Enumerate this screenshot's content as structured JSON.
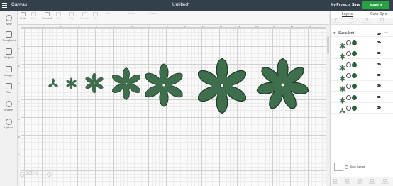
{
  "topbar": {
    "app_title": "Canvas",
    "doc_title": "Untitled*",
    "my_projects": "My Projects",
    "save": "Save",
    "make_it": "Make It"
  },
  "toolbar": {
    "items": [
      "Undo",
      "Redo",
      "Select All",
      "Edit",
      "Align",
      "Arrange",
      "Flip",
      "Size",
      "Rotate",
      "Position"
    ],
    "groups": [
      "Edit",
      "Align",
      "Arrange",
      "Flip",
      "Size",
      "Rotate",
      "Position"
    ]
  },
  "sidebar": {
    "items": [
      "New",
      "Templates",
      "Projects",
      "Images",
      "Text",
      "Shapes",
      "Upload"
    ]
  },
  "ruler": {
    "top": [
      "1",
      "2",
      "3",
      "4",
      "5",
      "6",
      "7",
      "8",
      "9",
      "10",
      "11",
      "12",
      "13",
      "14",
      "15",
      "16"
    ],
    "left": [
      "1",
      "2",
      "3",
      "4",
      "5",
      "6",
      "7"
    ]
  },
  "canvas": {
    "zoom": "100%",
    "fill_color": "#3f6e4d",
    "flowers": [
      {
        "petals": 3,
        "hole": false
      },
      {
        "petals": 6,
        "hole": false
      },
      {
        "petals": 6,
        "hole": true
      },
      {
        "petals": 6,
        "hole": true
      },
      {
        "petals": 6,
        "hole": true
      },
      {
        "petals": 6,
        "hole": true
      },
      {
        "petals": 7,
        "hole": true
      }
    ]
  },
  "panel": {
    "tabs": [
      "Layers",
      "Color Sync"
    ],
    "tools": [
      "Group",
      "Ungroup",
      "Duplicate",
      "Delete"
    ],
    "group_name": "Succulent",
    "layers": [
      {
        "petals": 6
      },
      {
        "petals": 6
      },
      {
        "petals": 6
      },
      {
        "petals": 6
      },
      {
        "petals": 6
      },
      {
        "petals": 6
      },
      {
        "petals": 3
      }
    ],
    "blank_canvas": "Blank Canvas",
    "bottom_tools": [
      "Slice",
      "Weld",
      "Attach",
      "Flatten",
      "Contour"
    ]
  },
  "icons": {
    "menu": "hamburger-icon",
    "eye": "eye-icon",
    "cut": "cut-icon",
    "chevron": "chevron-down-icon"
  }
}
